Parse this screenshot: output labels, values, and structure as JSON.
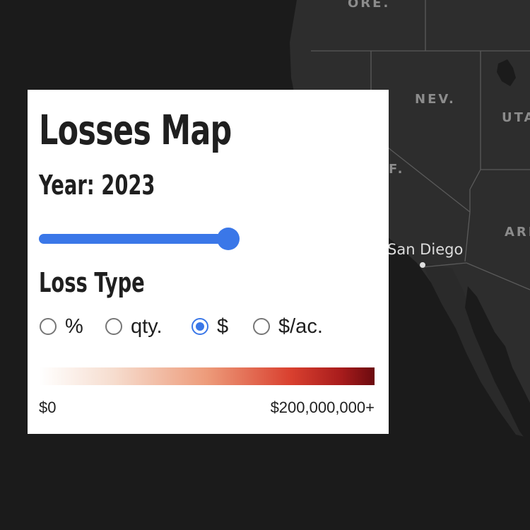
{
  "map": {
    "labels": {
      "ore": "ORE.",
      "nev": "NEV.",
      "uta": "UTA",
      "calif": "F.",
      "ari": "ARI"
    },
    "city": "San Diego"
  },
  "panel": {
    "title": "Losses Map",
    "year_label": "Year: 2023",
    "year_slider_fraction": 1.0,
    "loss_type_label": "Loss Type",
    "loss_types": [
      {
        "label": "%",
        "checked": false
      },
      {
        "label": "qty.",
        "checked": false
      },
      {
        "label": "$",
        "checked": true
      },
      {
        "label": "$/ac.",
        "checked": false
      }
    ],
    "scale": {
      "min_label": "$0",
      "max_label": "$200,000,000+"
    }
  },
  "colors": {
    "accent": "#3a77e8",
    "map_land": "#2c2c2c",
    "map_water": "#1b1b1b",
    "scale_low": "#ffffff",
    "scale_high": "#6b0a0f"
  }
}
